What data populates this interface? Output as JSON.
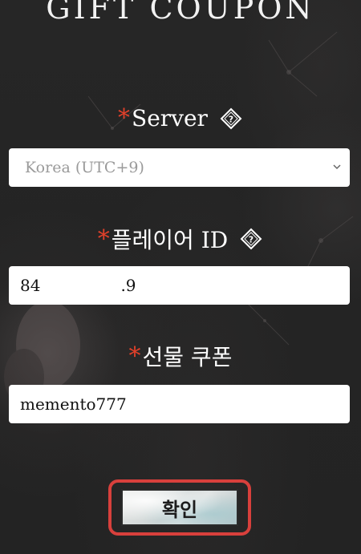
{
  "page": {
    "title": "GIFT COUPON"
  },
  "server": {
    "required_mark": "*",
    "label": "Server",
    "selected": "Korea (UTC+9)"
  },
  "player_id": {
    "required_mark": "*",
    "label": "플레이어 ID",
    "value_prefix": "84",
    "value_suffix": ".9"
  },
  "gift_coupon": {
    "required_mark": "*",
    "label": "선물 쿠폰",
    "value": "memento777"
  },
  "confirm": {
    "label": "확인"
  },
  "colors": {
    "background": "#232323",
    "required": "#e0402a",
    "highlight_border": "#d8403c"
  },
  "icons": {
    "help": "question-diamond-icon",
    "dropdown": "chevron-down-icon"
  }
}
